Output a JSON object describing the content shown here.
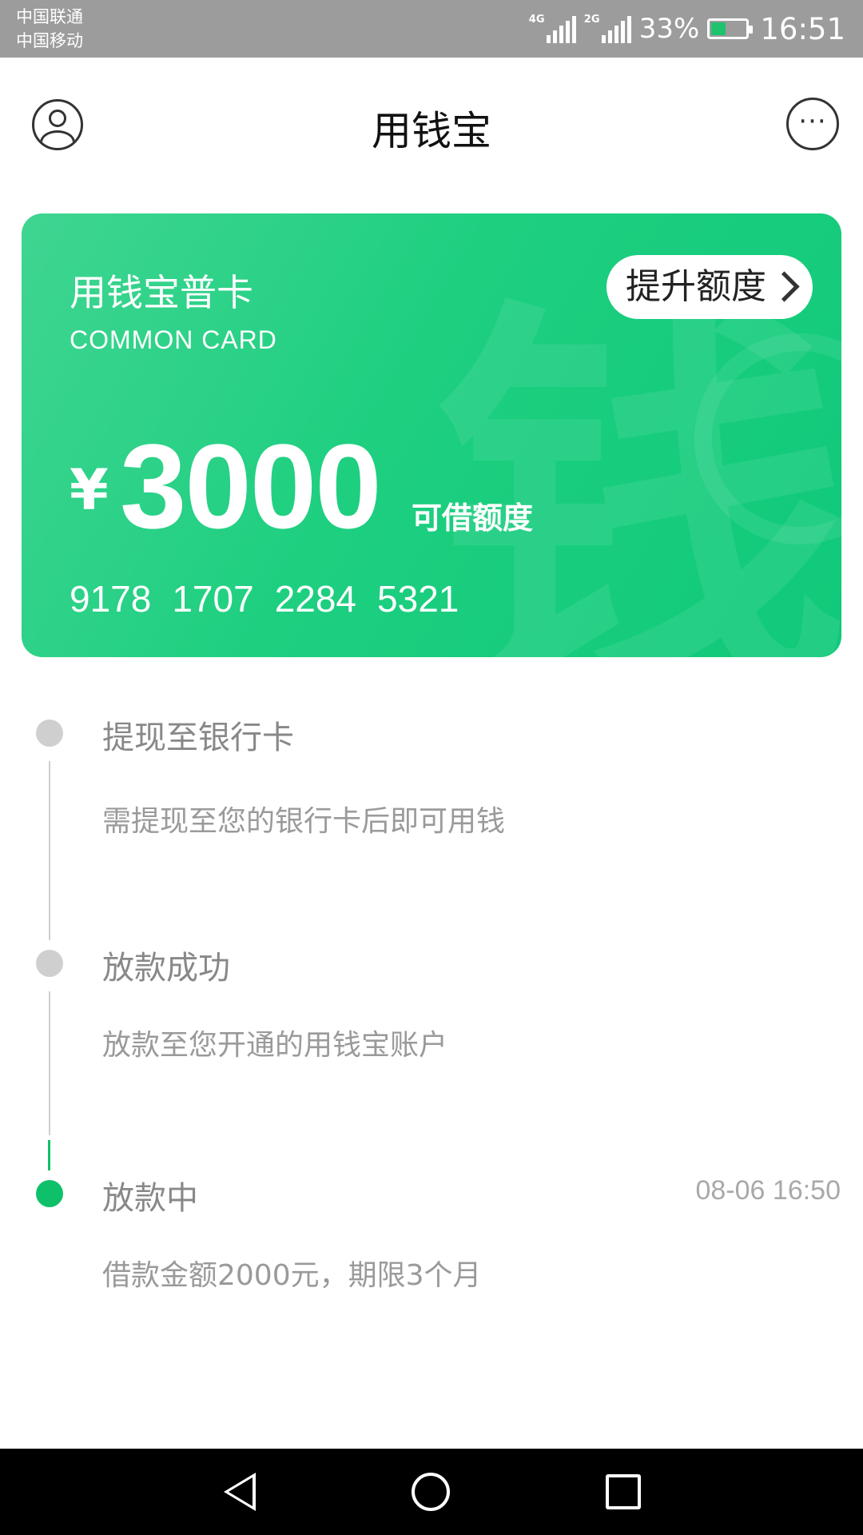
{
  "status_bar": {
    "carrier_1": "中国联通",
    "carrier_2": "中国移动",
    "signal_1_type": "4G",
    "signal_2_type": "2G",
    "battery": "33%",
    "time": "16:51"
  },
  "header": {
    "title": "用钱宝",
    "more_label": "···"
  },
  "card": {
    "name": "用钱宝普卡",
    "subtitle": "COMMON CARD",
    "raise_button": "提升额度",
    "currency": "¥",
    "amount": "3000",
    "amount_label": "可借额度",
    "number_groups": [
      "9178",
      "1707",
      "2284",
      "5321"
    ],
    "watermark": "钱",
    "accent_color": "#1ecf80"
  },
  "timeline": [
    {
      "title": "提现至银行卡",
      "desc": "需提现至您的银行卡后即可用钱",
      "time": "",
      "status": "pending"
    },
    {
      "title": "放款成功",
      "desc": "放款至您开通的用钱宝账户",
      "time": "",
      "status": "pending"
    },
    {
      "title": "放款中",
      "desc": "借款金额2000元，期限3个月",
      "time": "08-06 16:50",
      "status": "current"
    }
  ],
  "navbar": {
    "back": "back-icon",
    "home": "home-icon",
    "recent": "recent-apps-icon"
  }
}
